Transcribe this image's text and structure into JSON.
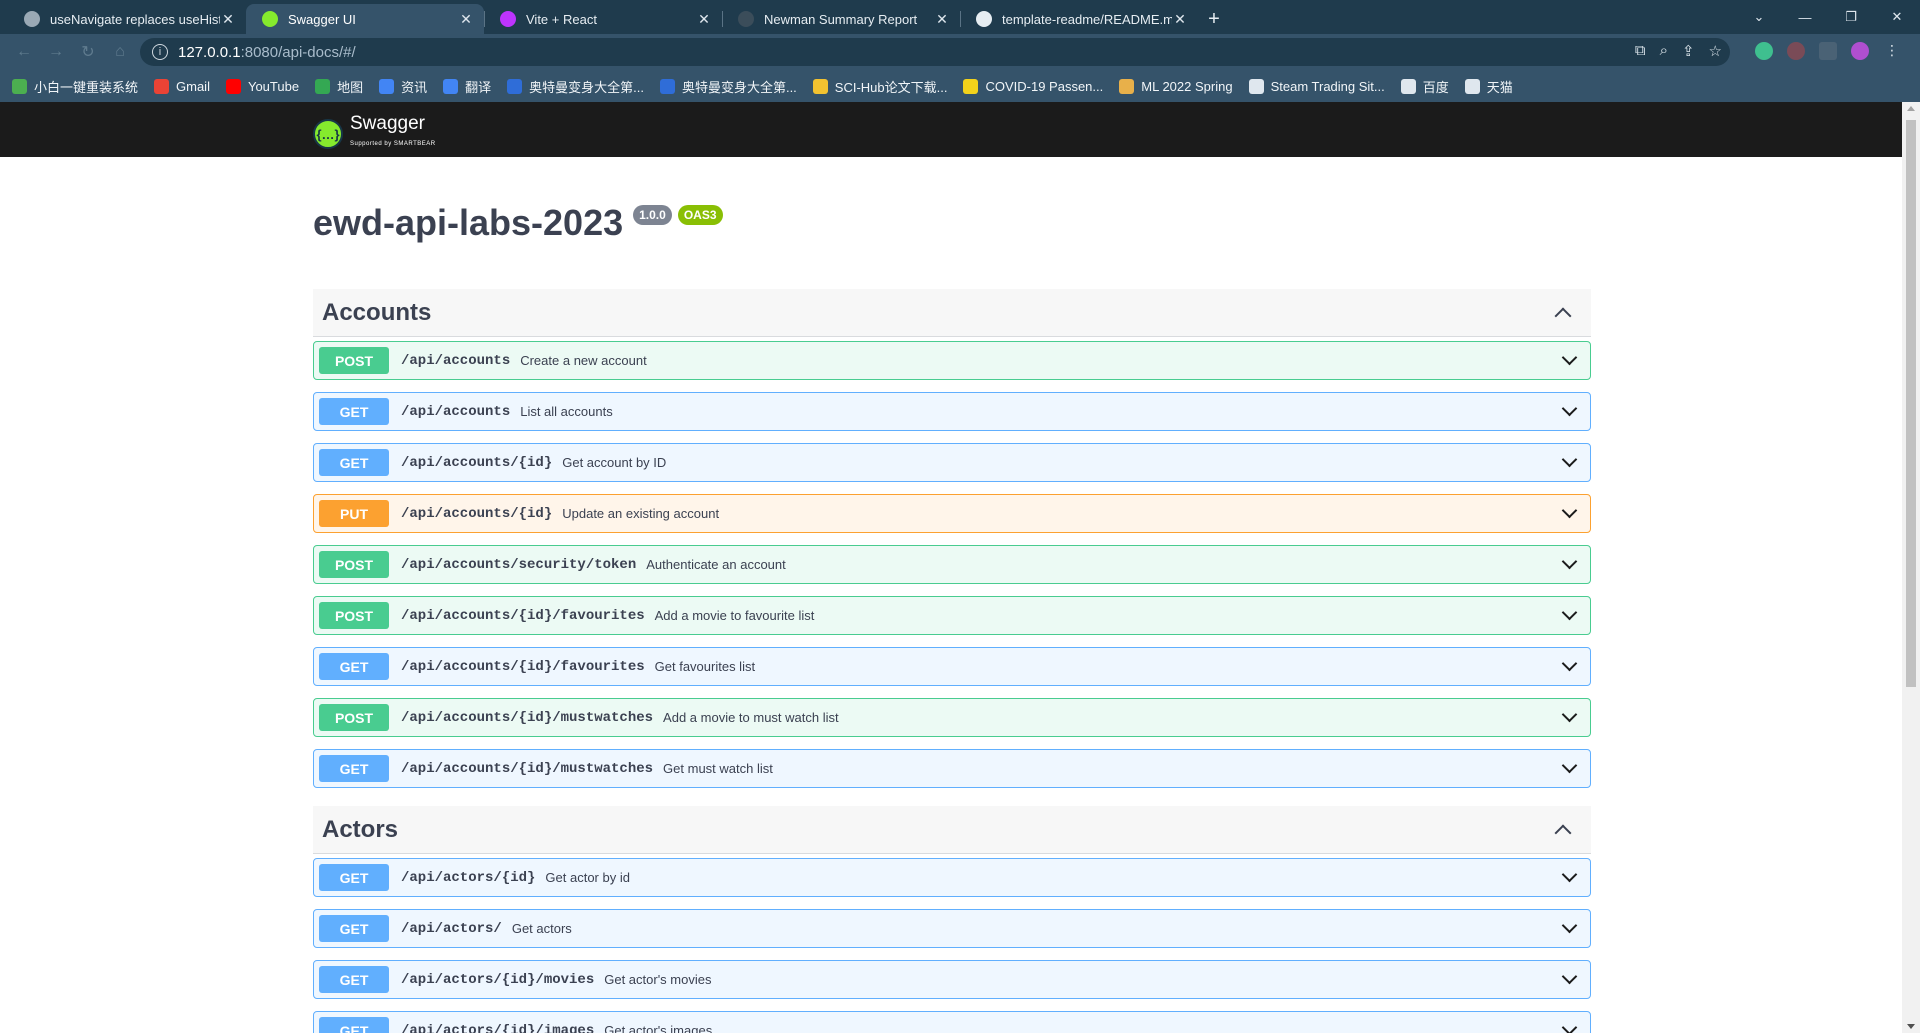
{
  "browser": {
    "tabs": [
      {
        "title": "useNavigate replaces useHistory",
        "favicon_color": "#9aa9b5",
        "active": false
      },
      {
        "title": "Swagger UI",
        "favicon_color": "#85ea2d",
        "active": true
      },
      {
        "title": "Vite + React",
        "favicon_color": "#bd34fe",
        "active": false
      },
      {
        "title": "Newman Summary Report",
        "favicon_color": "#3b4d5a",
        "active": false
      },
      {
        "title": "template-readme/README.md",
        "favicon_color": "#e6edf2",
        "active": false
      }
    ],
    "new_tab_label": "+",
    "window_controls": {
      "dropdown": "⌄",
      "minimize": "—",
      "restore": "❐",
      "close": "✕"
    },
    "address": {
      "host": "127.0.0.1",
      "path": ":8080/api-docs/#/"
    },
    "bookmarks": [
      {
        "label": "小白一键重装系统",
        "color": "#4caf50"
      },
      {
        "label": "Gmail",
        "color": "#ea4335"
      },
      {
        "label": "YouTube",
        "color": "#ff0000"
      },
      {
        "label": "地图",
        "color": "#34a853"
      },
      {
        "label": "资讯",
        "color": "#4285f4"
      },
      {
        "label": "翻译",
        "color": "#4285f4"
      },
      {
        "label": "奥特曼变身大全第...",
        "color": "#2f6dd8"
      },
      {
        "label": "奥特曼变身大全第...",
        "color": "#2f6dd8"
      },
      {
        "label": "SCI-Hub论文下载...",
        "color": "#f2c230"
      },
      {
        "label": "COVID-19 Passen...",
        "color": "#f2d21b"
      },
      {
        "label": "ML 2022 Spring",
        "color": "#e8b04a"
      },
      {
        "label": "Steam Trading Sit...",
        "color": "#dfe7ee"
      },
      {
        "label": "百度",
        "color": "#dfe7ee"
      },
      {
        "label": "天猫",
        "color": "#dfe7ee"
      }
    ]
  },
  "swagger": {
    "logo": {
      "mark": "{…}",
      "brand": "Swagger",
      "sub": "Supported by SMARTBEAR"
    },
    "title": "ewd-api-labs-2023",
    "version": "1.0.0",
    "oas": "OAS3",
    "tags": [
      {
        "name": "Accounts",
        "operations": [
          {
            "method": "POST",
            "path": "/api/accounts",
            "summary": "Create a new account"
          },
          {
            "method": "GET",
            "path": "/api/accounts",
            "summary": "List all accounts"
          },
          {
            "method": "GET",
            "path": "/api/accounts/{id}",
            "summary": "Get account by ID"
          },
          {
            "method": "PUT",
            "path": "/api/accounts/{id}",
            "summary": "Update an existing account"
          },
          {
            "method": "POST",
            "path": "/api/accounts/security/token",
            "summary": "Authenticate an account"
          },
          {
            "method": "POST",
            "path": "/api/accounts/{id}/favourites",
            "summary": "Add a movie to favourite list"
          },
          {
            "method": "GET",
            "path": "/api/accounts/{id}/favourites",
            "summary": "Get favourites list"
          },
          {
            "method": "POST",
            "path": "/api/accounts/{id}/mustwatches",
            "summary": "Add a movie to must watch list"
          },
          {
            "method": "GET",
            "path": "/api/accounts/{id}/mustwatches",
            "summary": "Get must watch list"
          }
        ]
      },
      {
        "name": "Actors",
        "operations": [
          {
            "method": "GET",
            "path": "/api/actors/{id}",
            "summary": "Get actor by id"
          },
          {
            "method": "GET",
            "path": "/api/actors/",
            "summary": "Get actors"
          },
          {
            "method": "GET",
            "path": "/api/actors/{id}/movies",
            "summary": "Get actor's movies"
          },
          {
            "method": "GET",
            "path": "/api/actors/{id}/images",
            "summary": "Get actor's images"
          }
        ]
      }
    ]
  }
}
